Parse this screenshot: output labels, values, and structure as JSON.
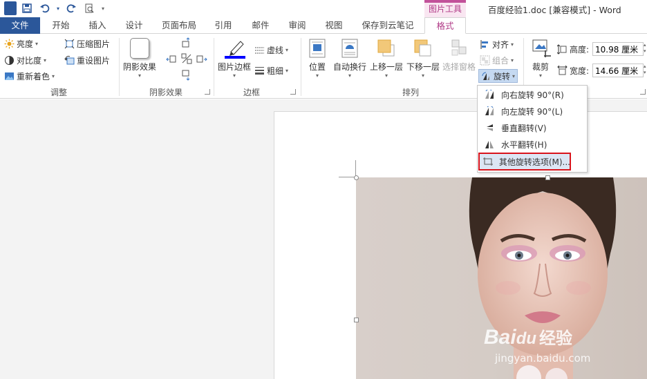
{
  "titlebar": {
    "app_logo": "W",
    "qat_icons": [
      "save-icon",
      "undo-icon",
      "redo-icon",
      "print-preview-icon",
      "customize-icon"
    ],
    "context_label": "图片工具",
    "doc_title": "百度经验1.doc [兼容模式] - Word",
    "accent": "#2b579a",
    "context_accent": "#c2519a"
  },
  "tabs": [
    {
      "label": "文件"
    },
    {
      "label": "开始"
    },
    {
      "label": "插入"
    },
    {
      "label": "设计"
    },
    {
      "label": "页面布局"
    },
    {
      "label": "引用"
    },
    {
      "label": "邮件"
    },
    {
      "label": "审阅"
    },
    {
      "label": "视图"
    },
    {
      "label": "保存到云笔记"
    },
    {
      "label": "格式"
    }
  ],
  "ribbon": {
    "adjust": {
      "brightness": "亮度",
      "contrast": "对比度",
      "recolor": "重新着色",
      "compress": "压缩图片",
      "reset": "重设图片",
      "label": "调整"
    },
    "shadow": {
      "effects": "阴影效果",
      "label": "阴影效果"
    },
    "border": {
      "picture_border": "图片边框",
      "dashes": "虚线",
      "weight": "粗细",
      "label": "边框",
      "border_color": "#0000ff"
    },
    "arrange": {
      "position": "位置",
      "wrap": "自动换行",
      "bring_forward": "上移一层",
      "send_backward": "下移一层",
      "selection_pane": "选择窗格",
      "align": "对齐",
      "group": "组合",
      "rotate": "旋转",
      "label": "排列"
    },
    "size": {
      "crop": "裁剪",
      "height_label": "高度:",
      "height_value": "10.98 厘米",
      "width_label": "宽度:",
      "width_value": "14.66 厘米"
    }
  },
  "rotate_menu": [
    {
      "label": "向右旋转 90°(R)",
      "icon": "rotate-right-icon"
    },
    {
      "label": "向左旋转 90°(L)",
      "icon": "rotate-left-icon"
    },
    {
      "label": "垂直翻转(V)",
      "icon": "flip-vertical-icon"
    },
    {
      "label": "水平翻转(H)",
      "icon": "flip-horizontal-icon"
    },
    {
      "label": "其他旋转选项(M)...",
      "icon": "more-rotation-icon"
    }
  ],
  "watermark": {
    "brand": "Bai",
    "paw": "du",
    "cn": "经验",
    "url": "jingyan.baidu.com"
  }
}
